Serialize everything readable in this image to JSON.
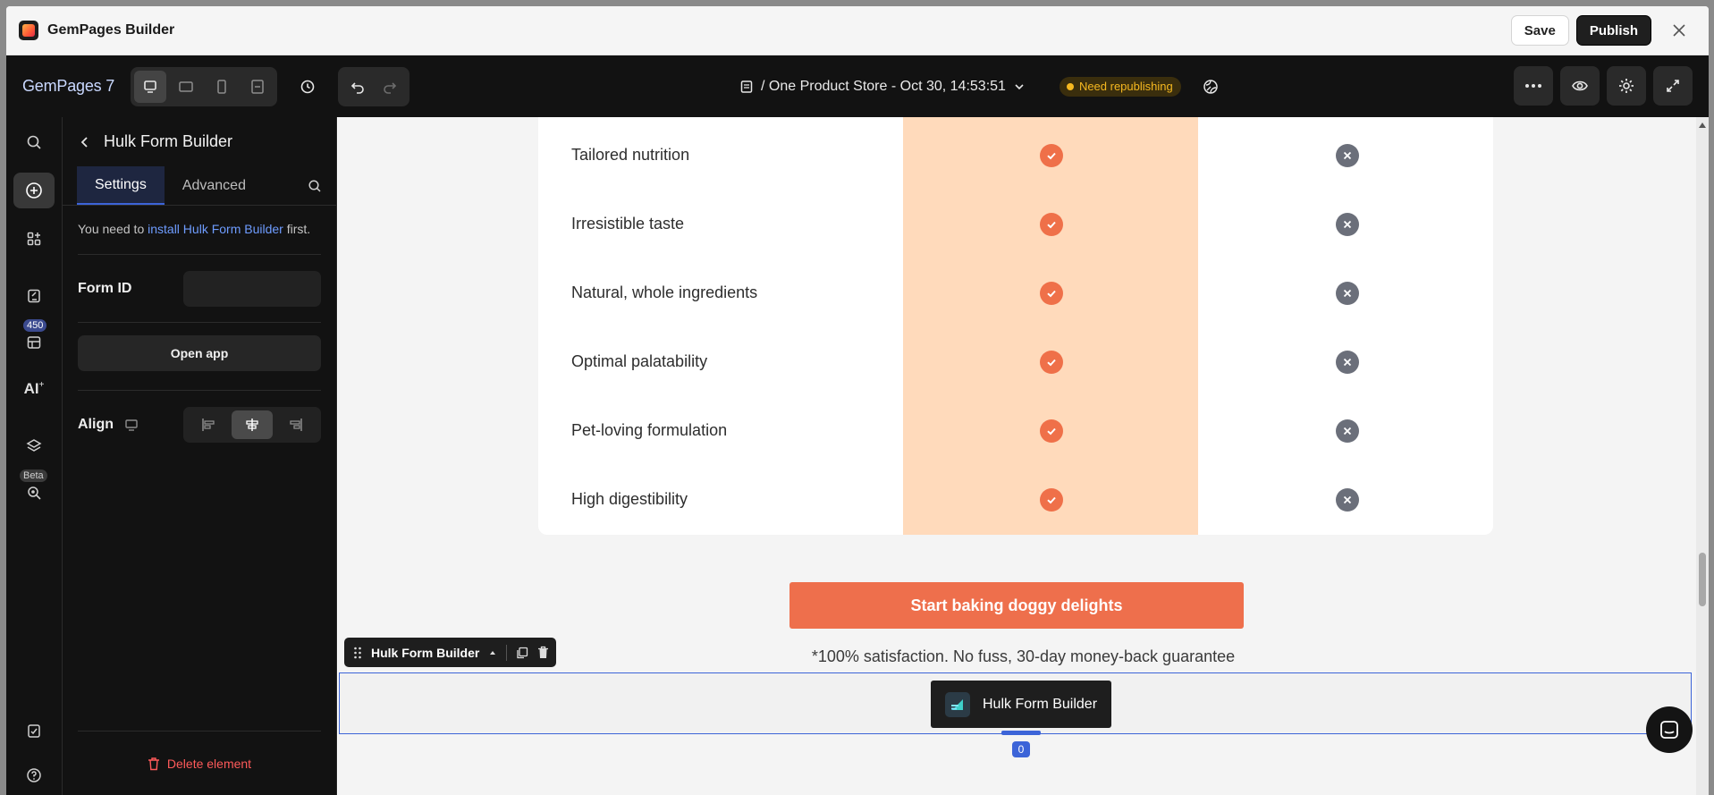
{
  "titlebar": {
    "title": "GemPages Builder",
    "save_label": "Save",
    "publish_label": "Publish"
  },
  "toolbar": {
    "brand": "GemPages 7",
    "doc_title": "/ One Product Store - Oct 30, 14:53:51",
    "status_badge": "Need republishing"
  },
  "rail": {
    "badge_count": "450",
    "beta_label": "Beta",
    "ai_label": "AI"
  },
  "panel": {
    "title": "Hulk Form Builder",
    "tabs": [
      {
        "label": "Settings"
      },
      {
        "label": "Advanced"
      }
    ],
    "notice_prefix": "You need to ",
    "notice_link": "install Hulk Form Builder",
    "notice_suffix": " first.",
    "form_id_label": "Form ID",
    "form_id_value": "",
    "open_app_label": "Open app",
    "align_label": "Align",
    "delete_label": "Delete element"
  },
  "canvas": {
    "features": [
      {
        "label": "Tailored nutrition"
      },
      {
        "label": "Irresistible taste"
      },
      {
        "label": "Natural, whole ingredients"
      },
      {
        "label": "Optimal palatability"
      },
      {
        "label": "Pet-loving formulation"
      },
      {
        "label": "High digestibility"
      }
    ],
    "cta_label": "Start baking doggy delights",
    "guarantee": "*100% satisfaction. No fuss, 30-day money-back guarantee",
    "selected_element_label": "Hulk Form Builder",
    "hulk_button_label": "Hulk Form Builder",
    "selection_count": "0"
  },
  "colors": {
    "accent": "#ee6f4c",
    "highlight_column": "#ffdabb",
    "selection": "#3c64d8",
    "warning": "#f5b820"
  }
}
